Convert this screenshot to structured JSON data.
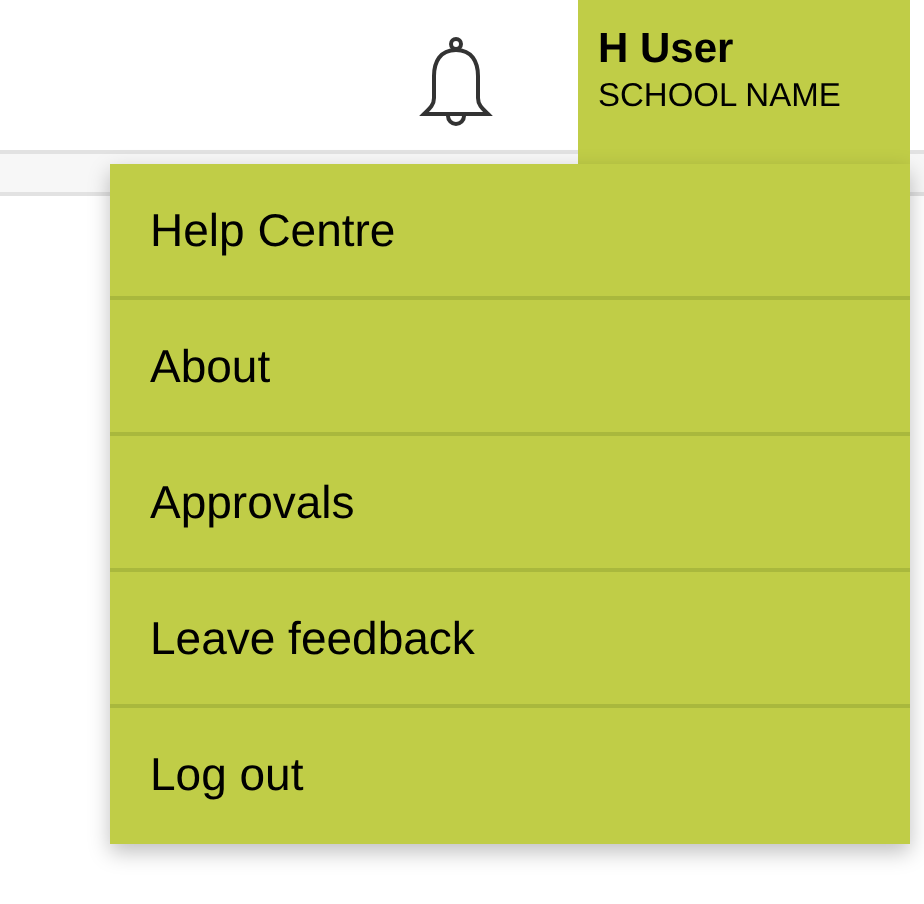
{
  "header": {
    "user": {
      "name": "H User",
      "school": "SCHOOL NAME"
    }
  },
  "menu": {
    "items": [
      {
        "label": "Help Centre"
      },
      {
        "label": "About"
      },
      {
        "label": "Approvals"
      },
      {
        "label": "Leave feedback"
      },
      {
        "label": "Log out"
      }
    ]
  }
}
